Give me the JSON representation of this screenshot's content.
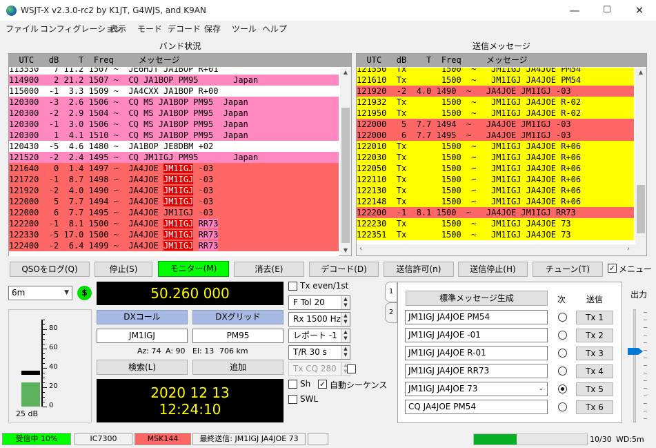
{
  "window": {
    "title": "WSJT-X   v2.3.0-rc2   by K1JT, G4WJS, and K9AN",
    "minimize": "—",
    "maximize": "☐",
    "close": "✕"
  },
  "menu": [
    "ファイル",
    "コンフィグレーション",
    "表示",
    "モード",
    "デコード",
    "保存",
    "ツール",
    "ヘルプ"
  ],
  "band_activity": {
    "label": "バンド状況",
    "header": "  UTC   dB    T  Freq     メッセージ",
    "rows": [
      {
        "text": "113530   7 11.2 1507 ~  JE6HJT JA1BOP R+01",
        "bg": "#ffffff",
        "cut": true
      },
      {
        "text": "114900   2 21.2 1507 ~  CQ JA1BOP PM95       Japan",
        "bg": "#ff88c0"
      },
      {
        "text": "115000  -1  3.3 1509 ~  JA4CXX JA1BOP R+00",
        "bg": "#ffffff"
      },
      {
        "text": "120300  -3  2.6 1506 ~  CQ MS JA1BOP PM95  Japan",
        "bg": "#ff88c0"
      },
      {
        "text": "120300  -2  2.9 1504 ~  CQ MS JA1BOP PM95  Japan",
        "bg": "#ff88c0"
      },
      {
        "text": "120300  -1  3.0 1506 ~  CQ MS JA1BOP PM95  Japan",
        "bg": "#ff88c0"
      },
      {
        "text": "120300   1  4.1 1510 ~  CQ MS JA1BOP PM95  Japan",
        "bg": "#ff88c0"
      },
      {
        "text": "120430  -5  4.6 1480 ~  JA1BOP JE8DBM +02",
        "bg": "#ffffff"
      },
      {
        "text": "121520  -2  2.4 1495 ~  CQ JM1IGJ PM95       Japan",
        "bg": "#ff88c0"
      },
      {
        "pre": "121640   0  1.4 1497 ~  JA4JOE ",
        "hl": "JM1IGJ",
        "post": " -03",
        "bg": "#ff6666"
      },
      {
        "pre": "121720  -1  8.7 1498 ~  JA4JOE ",
        "hl": "JM1IGJ",
        "post": " -03",
        "bg": "#ff6666"
      },
      {
        "pre": "121920  -2  4.0 1490 ~  JA4JOE ",
        "hl": "JM1IGJ",
        "post": " -03",
        "bg": "#ff6666"
      },
      {
        "pre": "122000   5  7.7 1494 ~  JA4JOE ",
        "hl": "JM1IGJ",
        "post": " -03",
        "bg": "#ff6666"
      },
      {
        "text": "122000   6  7.7 1495 ~  JA4JOE JM1IGJ -03",
        "bg": "#ff6666"
      },
      {
        "pre": "122200  -1  8.1 1500 ~  JA4JOE ",
        "hl": "JM1IGJ",
        "rr": "RR73",
        "bg": "#ff6666"
      },
      {
        "pre": "122330  -5 17.0 1500 ~  JA4JOE ",
        "hl": "JM1IGJ",
        "rr": "RR73",
        "bg": "#ff6666"
      },
      {
        "pre": "122400  -2  6.4 1499 ~  JA4JOE ",
        "hl": "JM1IGJ",
        "rr": "RR73",
        "bg": "#ff6666"
      }
    ]
  },
  "rx_freq": {
    "label": "送信メッセージ",
    "header": "  UTC   dB    T  Freq     メッセージ",
    "rows": [
      {
        "text": "121550  Tx       1500  ~   JM1IGJ JA4JOE PM54",
        "bg": "#ffff00",
        "cut": true
      },
      {
        "text": "121610  Tx       1500  ~   JM1IGJ JA4JOE PM54",
        "bg": "#ffff00"
      },
      {
        "text": "121920  -2  4.0 1490  ~   JA4JOE JM1IGJ -03",
        "bg": "#ff6666"
      },
      {
        "text": "121932  Tx       1500  ~   JM1IGJ JA4JOE R-02",
        "bg": "#ffff00"
      },
      {
        "text": "121950  Tx       1500  ~   JM1IGJ JA4JOE R-02",
        "bg": "#ffff00"
      },
      {
        "text": "122000   5  7.7 1494  ~   JA4JOE JM1IGJ -03",
        "bg": "#ff6666"
      },
      {
        "text": "122000   6  7.7 1495  ~   JA4JOE JM1IGJ -03",
        "bg": "#ff6666"
      },
      {
        "text": "122010  Tx       1500  ~   JM1IGJ JA4JOE R+06",
        "bg": "#ffff00"
      },
      {
        "text": "122030  Tx       1500  ~   JM1IGJ JA4JOE R+06",
        "bg": "#ffff00"
      },
      {
        "text": "122050  Tx       1500  ~   JM1IGJ JA4JOE R+06",
        "bg": "#ffff00"
      },
      {
        "text": "122110  Tx       1500  ~   JM1IGJ JA4JOE R+06",
        "bg": "#ffff00"
      },
      {
        "text": "122130  Tx       1500  ~   JM1IGJ JA4JOE R+06",
        "bg": "#ffff00"
      },
      {
        "text": "122148  Tx       1500  ~   JM1IGJ JA4JOE R+06",
        "bg": "#ffff00"
      },
      {
        "text": "122200  -1  8.1 1500  ~   JA4JOE JM1IGJ RR73",
        "bg": "#ff6666"
      },
      {
        "text": "122230  Tx       1500  ~   JM1IGJ JA4JOE 73",
        "bg": "#ffff00"
      },
      {
        "text": "122351  Tx       1500  ~   JM1IGJ JA4JOE 73",
        "bg": "#ffff00"
      }
    ]
  },
  "buttons": {
    "log_qso": "QSOをログ(Q)",
    "stop": "停止(S)",
    "monitor": "モニター(M)",
    "erase": "消去(E)",
    "decode": "デコード(D)",
    "enable_tx": "送信許可(n)",
    "halt_tx": "送信停止(H)",
    "tune": "チューン(T)",
    "menus": "メニュー"
  },
  "band": {
    "value": "6m",
    "dollar": "$"
  },
  "meter": {
    "ticks": [
      "80",
      "60",
      "40",
      "20",
      "0"
    ],
    "level_db": "25 dB",
    "level_value": 25,
    "peak_value": 35,
    "scale_max": 90
  },
  "freq": {
    "dial": "50.260 000"
  },
  "dx": {
    "call_label": "DXコール",
    "grid_label": "DXグリッド",
    "call": "JM1IGJ",
    "grid": "PM95",
    "az": "Az: 74",
    "a": "A: 90",
    "el": "El: 13",
    "dist": "706 km",
    "lookup": "検索(L)",
    "add": "追加"
  },
  "clock": {
    "date": "2020 12 13",
    "time": "12:24:10"
  },
  "controls": {
    "tx_even": "Tx even/1st",
    "ftol": "F Tol  20",
    "rx": "Rx  1500  Hz",
    "report": "レポート -1",
    "tr": "T/R  30  s",
    "txcq": "Tx CQ  280",
    "sh": "Sh",
    "auto_seq": "自動シーケンス",
    "swl": "SWL"
  },
  "messages": {
    "tab1": "1",
    "tab2": "2",
    "gen": "標準メッセージ生成",
    "next": "次",
    "send": "送信",
    "items": [
      {
        "text": "JM1IGJ JA4JOE PM54",
        "tx": "Tx 1",
        "selected": false
      },
      {
        "text": "JM1IGJ JA4JOE -01",
        "tx": "Tx 2",
        "selected": false
      },
      {
        "text": "JM1IGJ JA4JOE R-01",
        "tx": "Tx 3",
        "selected": false
      },
      {
        "text": "JM1IGJ JA4JOE RR73",
        "tx": "Tx 4",
        "selected": false
      },
      {
        "text": "JM1IGJ JA4JOE 73",
        "tx": "Tx 5",
        "selected": true
      },
      {
        "text": "CQ JA4JOE PM54",
        "tx": "Tx 6",
        "selected": false
      }
    ],
    "power_label": "出力"
  },
  "status": {
    "receiving": "受信中  10%",
    "rig": "IC7300",
    "mode": "MSK144",
    "last_tx": "最終送信: JM1IGJ JA4JOE 73",
    "progress_value": 0.38,
    "counter": "10/30",
    "wd": "WD:5m"
  },
  "colors": {
    "green": "#00ff00",
    "red": "#ff6666",
    "pink": "#ff88c0",
    "yellow": "#ffff00",
    "dial_bg": "#000000",
    "dial_fg": "#ffff00"
  }
}
